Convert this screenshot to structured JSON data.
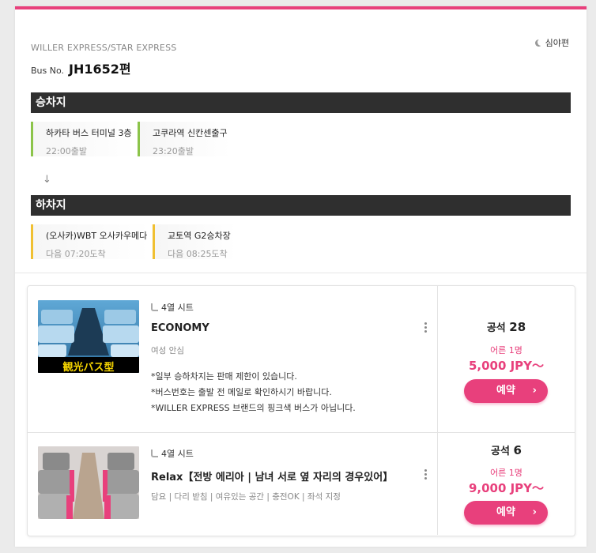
{
  "header": {
    "operator": "WILLER EXPRESS/STAR EXPRESS",
    "bus_no_label": "Bus No.",
    "bus_no": "JH1652편",
    "night_label": "심야편"
  },
  "boarding": {
    "title": "승차지",
    "stops": [
      {
        "name": "하카타 버스 터미널 3층",
        "time": "22:00출발"
      },
      {
        "name": "고쿠라역 신칸센출구",
        "time": "23:20출발"
      }
    ]
  },
  "alighting": {
    "title": "하차지",
    "stops": [
      {
        "name": "(오사카)WBT 오사카우메다",
        "time": "다음 07:20도착"
      },
      {
        "name": "교토역 G2승차장",
        "time": "다음 08:25도착"
      }
    ]
  },
  "seats": [
    {
      "image_caption": "観光バス型",
      "seat_config": "4열 시트",
      "name": "ECONOMY",
      "tags": "여성 안심",
      "notes": [
        "*일부 승하차지는 판매 제한이 있습니다.",
        "*버스번호는 출발 전 메일로 확인하시기 바랍니다.",
        "*WILLER EXPRESS 브랜드의 핑크색 버스가 아닙니다."
      ],
      "avail_label": "공석",
      "avail_count": "28",
      "adult_label": "어른 1명",
      "price": "5,000 JPY～",
      "book_label": "예약"
    },
    {
      "seat_config": "4열 시트",
      "name": "Relax【전방 에리아 | 남녀 서로 옆 자리의 경우있어】",
      "tags": "담요 | 다리 받침 | 여유있는 공간 | 충전OK | 좌석 지정",
      "avail_label": "공석",
      "avail_count": "6",
      "adult_label": "어른 1명",
      "price": "9,000 JPY～",
      "book_label": "예약"
    }
  ],
  "colors": {
    "accent": "#e8407c",
    "section_bar": "#2f2f2f",
    "boarding_marker": "#8cc44a",
    "alighting_marker": "#f0c032"
  }
}
